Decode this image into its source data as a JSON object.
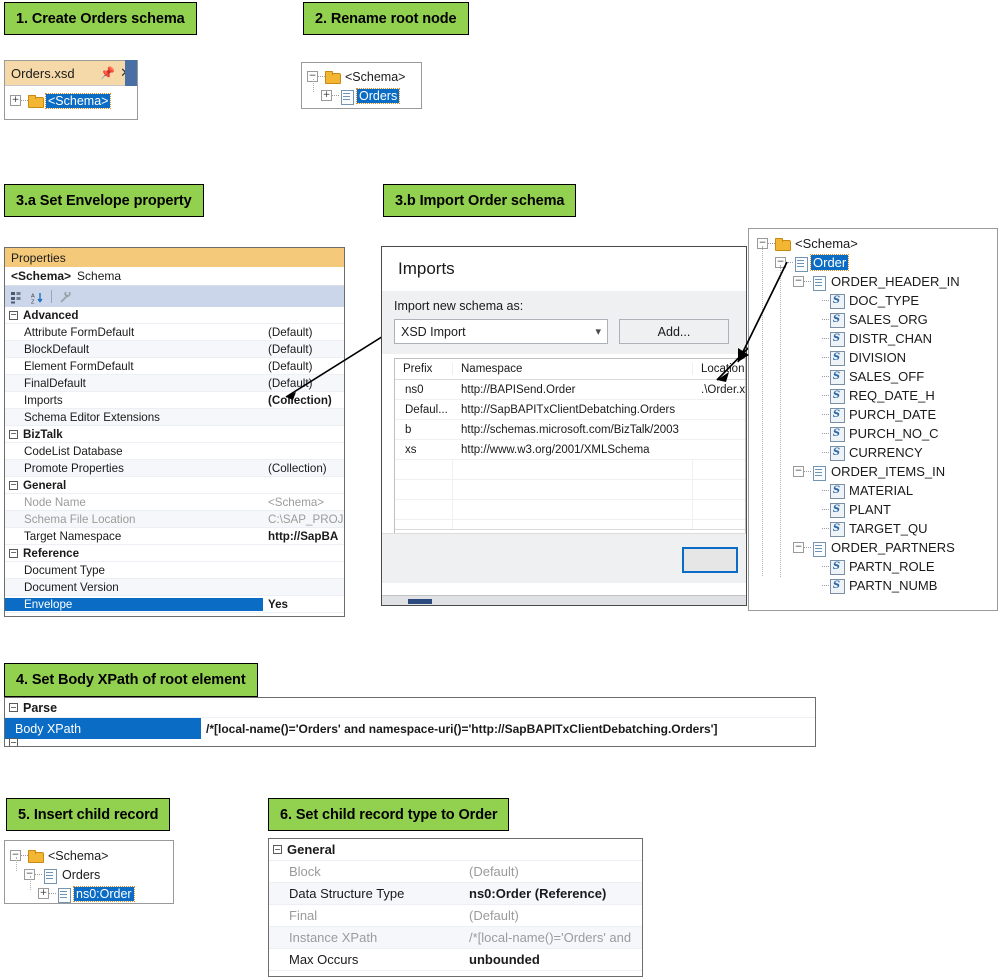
{
  "steps": {
    "s1": "1. Create Orders schema",
    "s2": "2. Rename root node",
    "s3a": "3.a Set Envelope property",
    "s3b": "3.b Import Order schema",
    "s4": "4. Set Body XPath of root element",
    "s5": "5. Insert child record",
    "s6": "6. Set child record type to Order"
  },
  "colors": {
    "accent_green": "#92d050",
    "selection_blue": "#0a6cc4",
    "tab_orange": "#f5d9a8"
  },
  "step1": {
    "tab_title": "Orders.xsd",
    "pin_icon": "pin-icon",
    "close_icon": "close-icon",
    "tree": [
      {
        "label": "<Schema>",
        "icon": "folder-icon",
        "expander": "+",
        "selected": true,
        "indent": 0
      }
    ]
  },
  "step2": {
    "tree": [
      {
        "label": "<Schema>",
        "icon": "folder-icon",
        "expander": "−",
        "selected": false,
        "indent": 0
      },
      {
        "label": "Orders",
        "icon": "record-icon",
        "expander": "+",
        "selected": true,
        "indent": 1
      }
    ]
  },
  "step3a": {
    "panel_title": "Properties",
    "object_name": "<Schema>",
    "object_type": "Schema",
    "toolbar_icons": [
      "categorized-icon",
      "alphabetical-icon",
      "property-pages-icon"
    ],
    "rows": [
      {
        "kind": "group",
        "name": "Advanced",
        "value": ""
      },
      {
        "kind": "prop",
        "name": "Attribute FormDefault",
        "value": "(Default)",
        "bold": false,
        "dim": false
      },
      {
        "kind": "prop",
        "name": "BlockDefault",
        "value": "(Default)",
        "bold": false,
        "dim": false
      },
      {
        "kind": "prop",
        "name": "Element FormDefault",
        "value": "(Default)",
        "bold": false,
        "dim": false
      },
      {
        "kind": "prop",
        "name": "FinalDefault",
        "value": "(Default)",
        "bold": false,
        "dim": false
      },
      {
        "kind": "prop",
        "name": "Imports",
        "value": "(Collection)",
        "bold": true,
        "dim": false
      },
      {
        "kind": "prop",
        "name": "Schema Editor Extensions",
        "value": "",
        "bold": false,
        "dim": false
      },
      {
        "kind": "group",
        "name": "BizTalk",
        "value": ""
      },
      {
        "kind": "prop",
        "name": "CodeList Database",
        "value": "",
        "bold": false,
        "dim": false
      },
      {
        "kind": "prop",
        "name": "Promote Properties",
        "value": "(Collection)",
        "bold": false,
        "dim": false
      },
      {
        "kind": "group",
        "name": "General",
        "value": ""
      },
      {
        "kind": "prop",
        "name": "Node Name",
        "value": "<Schema>",
        "bold": false,
        "dim": true
      },
      {
        "kind": "prop",
        "name": "Schema File Location",
        "value": "C:\\SAP_PROJE",
        "bold": false,
        "dim": true
      },
      {
        "kind": "prop",
        "name": "Target Namespace",
        "value": "http://SapBA",
        "bold": true,
        "dim": false
      },
      {
        "kind": "group",
        "name": "Reference",
        "value": ""
      },
      {
        "kind": "prop",
        "name": "Document Type",
        "value": "",
        "bold": false,
        "dim": false
      },
      {
        "kind": "prop",
        "name": "Document Version",
        "value": "",
        "bold": false,
        "dim": false
      },
      {
        "kind": "prop",
        "name": "Envelope",
        "value": "Yes",
        "bold": true,
        "dim": false,
        "selected": true
      }
    ]
  },
  "step3b": {
    "dialog_title": "Imports",
    "import_as_label": "Import new schema as:",
    "import_as_value": "XSD Import",
    "add_button": "Add...",
    "columns": [
      "Prefix",
      "Namespace",
      "Location"
    ],
    "rows": [
      {
        "prefix": "ns0",
        "namespace": "http://BAPISend.Order",
        "location": ".\\Order.xsd"
      },
      {
        "prefix": "Defaul...",
        "namespace": "http://SapBAPITxClientDebatching.Orders",
        "location": ""
      },
      {
        "prefix": "b",
        "namespace": "http://schemas.microsoft.com/BizTalk/2003",
        "location": ""
      },
      {
        "prefix": "xs",
        "namespace": "http://www.w3.org/2001/XMLSchema",
        "location": ""
      }
    ],
    "scroll_left_icon": "chevron-left-icon"
  },
  "step3b_tree": {
    "nodes": [
      {
        "label": "<Schema>",
        "icon": "folder-icon",
        "expander": "−",
        "indent": 0,
        "selected": false
      },
      {
        "label": "Order",
        "icon": "record-icon",
        "expander": "−",
        "indent": 1,
        "selected": true
      },
      {
        "label": "ORDER_HEADER_IN",
        "icon": "record-icon",
        "expander": "−",
        "indent": 2,
        "selected": false
      },
      {
        "label": "DOC_TYPE",
        "icon": "field-icon",
        "expander": "",
        "indent": 3,
        "selected": false
      },
      {
        "label": "SALES_ORG",
        "icon": "field-icon",
        "expander": "",
        "indent": 3,
        "selected": false
      },
      {
        "label": "DISTR_CHAN",
        "icon": "field-icon",
        "expander": "",
        "indent": 3,
        "selected": false
      },
      {
        "label": "DIVISION",
        "icon": "field-icon",
        "expander": "",
        "indent": 3,
        "selected": false
      },
      {
        "label": "SALES_OFF",
        "icon": "field-icon",
        "expander": "",
        "indent": 3,
        "selected": false
      },
      {
        "label": "REQ_DATE_H",
        "icon": "field-icon",
        "expander": "",
        "indent": 3,
        "selected": false
      },
      {
        "label": "PURCH_DATE",
        "icon": "field-icon",
        "expander": "",
        "indent": 3,
        "selected": false
      },
      {
        "label": "PURCH_NO_C",
        "icon": "field-icon",
        "expander": "",
        "indent": 3,
        "selected": false
      },
      {
        "label": "CURRENCY",
        "icon": "field-icon",
        "expander": "",
        "indent": 3,
        "selected": false
      },
      {
        "label": "ORDER_ITEMS_IN",
        "icon": "record-icon",
        "expander": "−",
        "indent": 2,
        "selected": false
      },
      {
        "label": "MATERIAL",
        "icon": "field-icon",
        "expander": "",
        "indent": 3,
        "selected": false
      },
      {
        "label": "PLANT",
        "icon": "field-icon",
        "expander": "",
        "indent": 3,
        "selected": false
      },
      {
        "label": "TARGET_QU",
        "icon": "field-icon",
        "expander": "",
        "indent": 3,
        "selected": false
      },
      {
        "label": "ORDER_PARTNERS",
        "icon": "record-icon",
        "expander": "−",
        "indent": 2,
        "selected": false
      },
      {
        "label": "PARTN_ROLE",
        "icon": "field-icon",
        "expander": "",
        "indent": 3,
        "selected": false
      },
      {
        "label": "PARTN_NUMB",
        "icon": "field-icon",
        "expander": "",
        "indent": 3,
        "selected": false
      }
    ]
  },
  "step4": {
    "group": "Parse",
    "property_name": "Body XPath",
    "property_value": "/*[local-name()='Orders' and namespace-uri()='http://SapBAPITxClientDebatching.Orders']"
  },
  "step5": {
    "tree": [
      {
        "label": "<Schema>",
        "icon": "folder-icon",
        "expander": "−",
        "indent": 0,
        "selected": false
      },
      {
        "label": "Orders",
        "icon": "record-icon",
        "expander": "−",
        "indent": 1,
        "selected": false
      },
      {
        "label": "ns0:Order",
        "icon": "record-icon",
        "expander": "+",
        "indent": 2,
        "selected": true
      }
    ]
  },
  "step6": {
    "rows": [
      {
        "kind": "group",
        "name": "General",
        "value": ""
      },
      {
        "kind": "prop",
        "name": "Block",
        "value": "(Default)",
        "bold": false,
        "dim": true
      },
      {
        "kind": "prop",
        "name": "Data Structure Type",
        "value": "ns0:Order (Reference)",
        "bold": true,
        "dim": false
      },
      {
        "kind": "prop",
        "name": "Final",
        "value": "(Default)",
        "bold": false,
        "dim": true
      },
      {
        "kind": "prop",
        "name": "Instance XPath",
        "value": "/*[local-name()='Orders' and",
        "bold": false,
        "dim": true
      },
      {
        "kind": "prop",
        "name": "Max Occurs",
        "value": "unbounded",
        "bold": true,
        "dim": false
      }
    ]
  }
}
